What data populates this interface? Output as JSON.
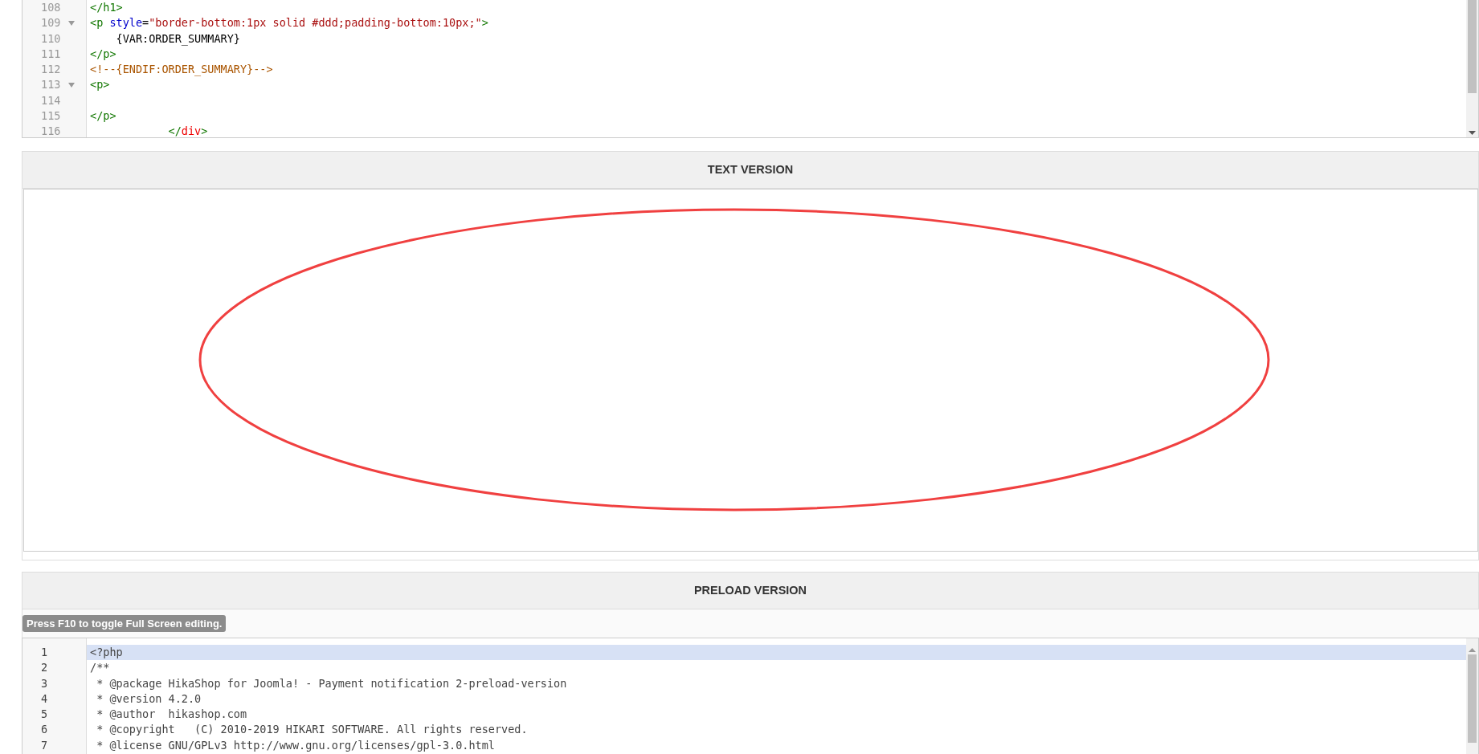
{
  "top_editor": {
    "lines": [
      {
        "number": "108",
        "foldable": false,
        "tokens": [
          {
            "kind": "tag",
            "text": "</h1>"
          }
        ]
      },
      {
        "number": "109",
        "foldable": true,
        "tokens": [
          {
            "kind": "tag",
            "text": "<p "
          },
          {
            "kind": "attribute",
            "text": "style"
          },
          {
            "kind": "plain",
            "text": "="
          },
          {
            "kind": "string",
            "text": "\"border-bottom:1px solid #ddd;padding-bottom:10px;\""
          },
          {
            "kind": "tag",
            "text": ">"
          }
        ]
      },
      {
        "number": "110",
        "foldable": false,
        "tokens": [
          {
            "kind": "plain",
            "text": "    {VAR:ORDER_SUMMARY}"
          }
        ]
      },
      {
        "number": "111",
        "foldable": false,
        "tokens": [
          {
            "kind": "tag",
            "text": "</p>"
          }
        ]
      },
      {
        "number": "112",
        "foldable": false,
        "tokens": [
          {
            "kind": "comment",
            "text": "<!--{ENDIF:ORDER_SUMMARY}-->"
          }
        ]
      },
      {
        "number": "113",
        "foldable": true,
        "tokens": [
          {
            "kind": "tag",
            "text": "<p>"
          }
        ]
      },
      {
        "number": "114",
        "foldable": false
      },
      {
        "number": "115",
        "foldable": false,
        "tokens": [
          {
            "kind": "tag",
            "text": "</p>"
          }
        ]
      },
      {
        "number": "116",
        "foldable": false,
        "tokens": [
          {
            "kind": "tag",
            "text": "            </"
          },
          {
            "kind": "tagname",
            "text": "div"
          },
          {
            "kind": "tag",
            "text": ">"
          }
        ]
      }
    ]
  },
  "text_version": {
    "title": "TEXT VERSION"
  },
  "preload_version": {
    "title": "PRELOAD VERSION",
    "tooltip": "Press F10 to toggle Full Screen editing.",
    "lines": [
      {
        "number": "1",
        "selected": true,
        "text": "<?php"
      },
      {
        "number": "2",
        "selected": false,
        "text": "/**"
      },
      {
        "number": "3",
        "selected": false,
        "text": " * @package HikaShop for Joomla! - Payment notification 2-preload-version"
      },
      {
        "number": "4",
        "selected": false,
        "text": " * @version 4.2.0"
      },
      {
        "number": "5",
        "selected": false,
        "text": " * @author  hikashop.com"
      },
      {
        "number": "6",
        "selected": false,
        "text": " * @copyright   (C) 2010-2019 HIKARI SOFTWARE. All rights reserved."
      },
      {
        "number": "7",
        "selected": false,
        "text": " * @license GNU/GPLv3 http://www.gnu.org/licenses/gpl-3.0.html"
      }
    ]
  }
}
